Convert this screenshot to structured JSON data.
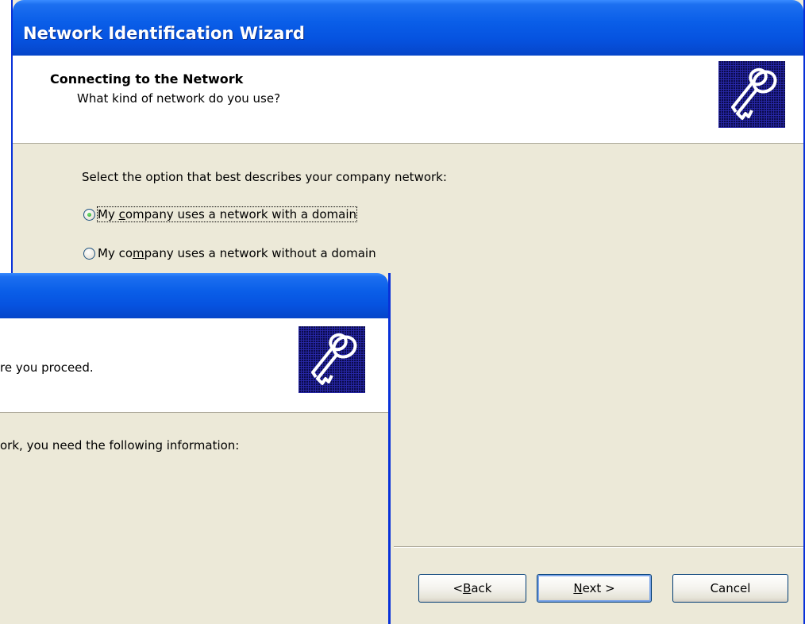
{
  "back_window": {
    "title": "Network Identification Wizard",
    "header_title": "Connecting to the Network",
    "header_subtitle": "What kind of network do you use?",
    "prompt": "Select the option that best describes your company network:",
    "options": [
      {
        "label_pre": "My ",
        "label_mnemonic": "c",
        "label_post": "ompany uses a network with a domain",
        "checked": true
      },
      {
        "label_pre": "My co",
        "label_mnemonic": "m",
        "label_post": "pany uses a network without a domain",
        "checked": false
      }
    ],
    "buttons": {
      "back": {
        "pre": "< ",
        "mnemonic": "B",
        "post": "ack"
      },
      "next": {
        "pre": "",
        "mnemonic": "N",
        "post": "ext >"
      },
      "cancel": "Cancel"
    },
    "icon": "keys-icon"
  },
  "front_window": {
    "header_text_fragment": "re you proceed.",
    "body_text_fragment": "ork, you need the following information:",
    "icon": "keys-icon"
  },
  "colors": {
    "title_blue": "#0653e0",
    "dialog_bg": "#ece9d8",
    "border_blue": "#0831d9"
  }
}
